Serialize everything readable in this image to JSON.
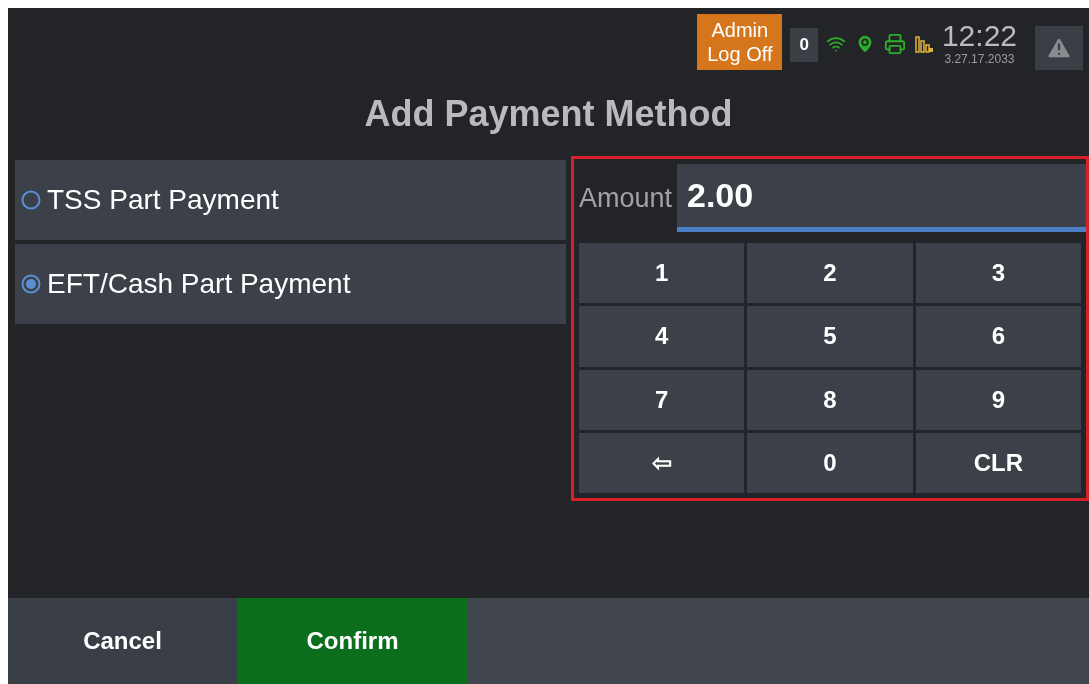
{
  "status_bar": {
    "admin_button": "Admin\nLog Off",
    "counter": "0",
    "time": "12:22",
    "date": "3.27.17.2033"
  },
  "title": "Add Payment Method",
  "payment_options": [
    {
      "label": "TSS Part Payment",
      "selected": false
    },
    {
      "label": "EFT/Cash Part Payment",
      "selected": true
    }
  ],
  "amount": {
    "label": "Amount",
    "value": "2.00"
  },
  "keypad": [
    "1",
    "2",
    "3",
    "4",
    "5",
    "6",
    "7",
    "8",
    "9",
    "⇦",
    "0",
    "CLR"
  ],
  "buttons": [
    {
      "label": "Cancel",
      "kind": "secondary"
    },
    {
      "label": "Confirm",
      "kind": "primary"
    }
  ]
}
